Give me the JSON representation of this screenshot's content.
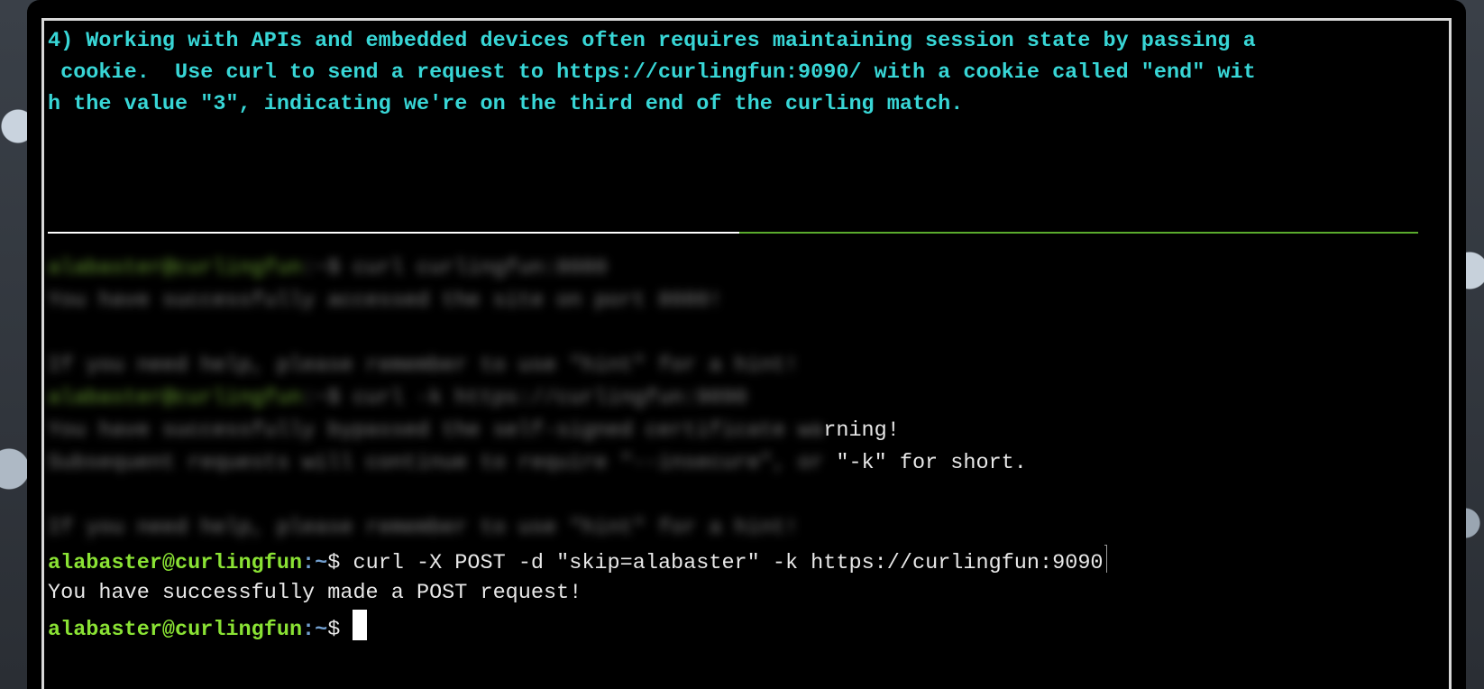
{
  "task": {
    "line1": "4) Working with APIs and embedded devices often requires maintaining session state by passing a",
    "line2": " cookie.  Use curl to send a request to https://curlingfun:9090/ with a cookie called \"end\" wit",
    "line3": "h the value \"3\", indicating we're on the third end of the curling match."
  },
  "colors": {
    "task_text": "#38d6d6",
    "prompt_user": "#8ae234",
    "prompt_path": "#729fcf",
    "progress_bar": "#5aab2d"
  },
  "history": {
    "blurred": [
      {
        "user": "alabaster@curlingfun",
        "cmd": ":~$ curl curlingfun:8080"
      },
      {
        "text": "You have successfully accessed the site on port 8080!"
      },
      {
        "text": ""
      },
      {
        "text": "If you need help, please remember to use \"hint\" for a hint!"
      },
      {
        "user": "alabaster@curlingfun",
        "cmd": ":~$ curl -k https://curlingfun:9090"
      },
      {
        "text": "You have successfully bypassed the self-signed certificate wa",
        "visible_tail": "rning!"
      },
      {
        "text": "Subsequent requests will continue to require \"--insecure\", or ",
        "visible_tail": "\"-k\" for short."
      },
      {
        "text": ""
      },
      {
        "text": "If you need help, please remember to use \"hint\" for a hint!"
      }
    ]
  },
  "prompt": {
    "user_host": "alabaster@curlingfun",
    "path": ":~",
    "dollar": "$ "
  },
  "last_command": "curl -X POST -d \"skip=alabaster\" -k https://curlingfun:9090",
  "last_output": "You have successfully made a POST request!"
}
